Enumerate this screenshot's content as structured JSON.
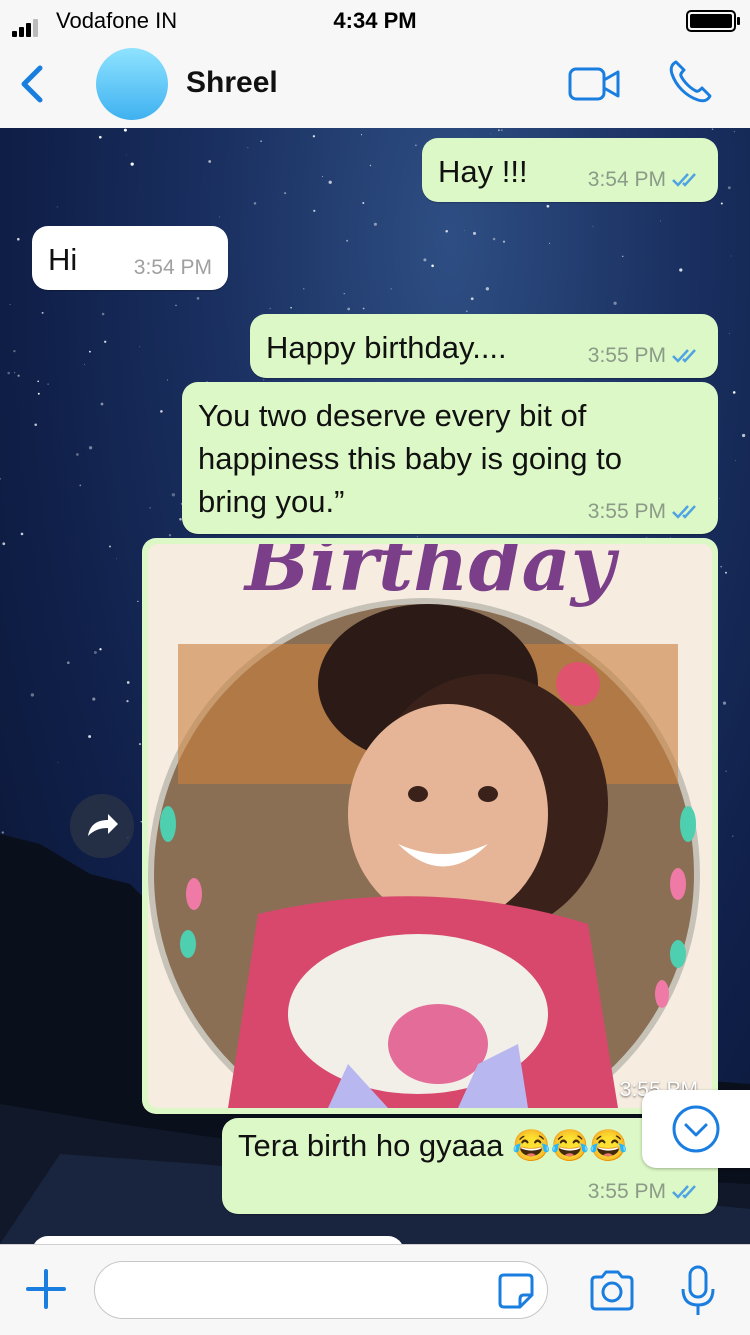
{
  "status_bar": {
    "carrier": "Vodafone IN",
    "time": "4:34 PM"
  },
  "header": {
    "contact_name": "Shreel"
  },
  "messages": [
    {
      "direction": "out",
      "text": "Hay !!!",
      "time": "3:54 PM"
    },
    {
      "direction": "in",
      "text": "Hi",
      "time": "3:54 PM"
    },
    {
      "direction": "out",
      "text": "Happy birthday....",
      "time": "3:55 PM"
    },
    {
      "direction": "out",
      "lines": [
        "You two deserve every bit of",
        "happiness this baby is going to",
        "bring you.”"
      ],
      "time": "3:55 PM"
    },
    {
      "direction": "out",
      "type": "image",
      "caption_art": "Birthday",
      "time": "3:55 PM"
    },
    {
      "direction": "out",
      "text": "Tera birth ho gyaaa 😂😂😂",
      "time": "3:55 PM"
    }
  ],
  "input": {
    "value": "",
    "placeholder": ""
  },
  "colors": {
    "accent": "#1a7ee0",
    "outgoing": "#dcf8c6",
    "incoming": "#ffffff",
    "read_ticks": "#4fa3e3"
  },
  "icons": [
    "back-chevron-icon",
    "video-call-icon",
    "phone-icon",
    "forward-icon",
    "scroll-down-icon",
    "plus-icon",
    "sticker-icon",
    "camera-icon",
    "microphone-icon",
    "double-check-icon"
  ]
}
